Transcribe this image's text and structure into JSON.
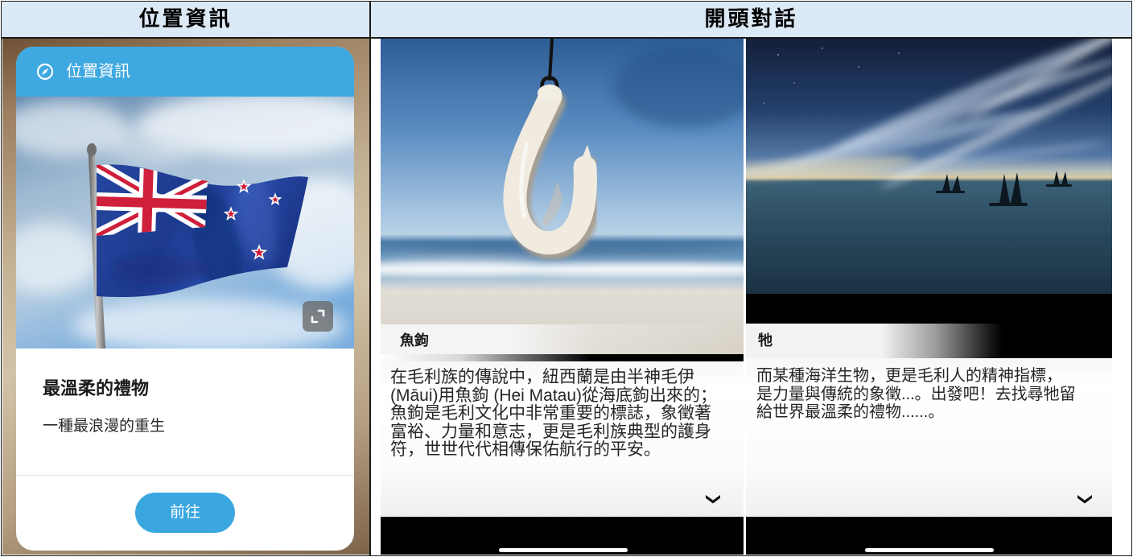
{
  "table": {
    "headers": [
      "位置資訊",
      "開頭對話"
    ]
  },
  "location_card": {
    "header_icon": "compass-icon",
    "header_title": "位置資訊",
    "expand_icon": "expand-icon",
    "title": "最溫柔的禮物",
    "subtitle": "一種最浪漫的重生",
    "button_label": "前往"
  },
  "dialogues": [
    {
      "title": "魚鉤",
      "lines": [
        "在毛利族的傳說中，紐西蘭是由半神毛伊",
        "(Māui)用魚鉤 (Hei Matau)從海底鉤出來的；",
        "魚鉤是毛利文化中非常重要的標誌，象徵著",
        "富裕、力量和意志，更是毛利族典型的護身",
        "符，世世代代相傳保佑航行的平安。"
      ],
      "more_icon": "chevron-down-icon"
    },
    {
      "title": "牠",
      "lines": [
        "而某種海洋生物，更是毛利人的精神指標，",
        "是力量與傳統的象徵...。出發吧！去找尋牠留",
        "給世界最溫柔的禮物......。"
      ],
      "more_icon": "chevron-down-icon"
    }
  ],
  "colors": {
    "table_header_bg": "#dbe9f6",
    "accent_blue": "#3ba7e0",
    "flag_blue": "#22419b",
    "flag_red": "#cf1f3a"
  }
}
